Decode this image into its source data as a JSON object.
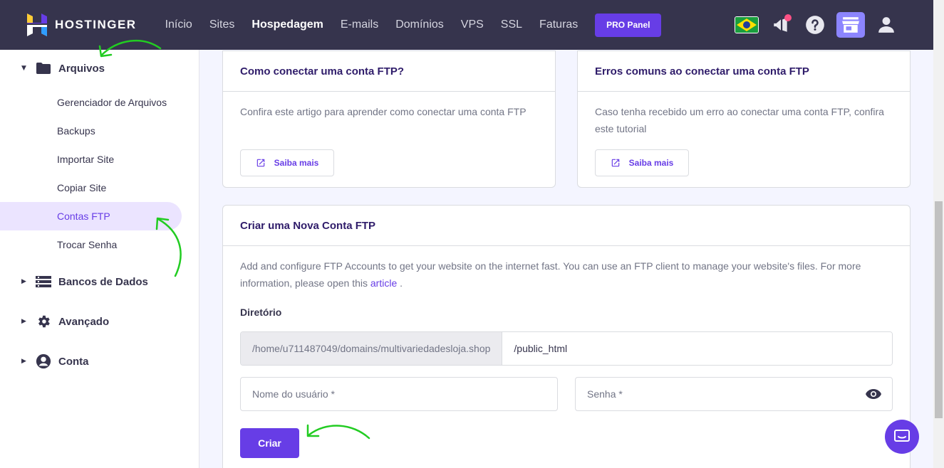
{
  "brand": {
    "name": "HOSTINGER"
  },
  "nav": {
    "items": [
      {
        "label": "Início"
      },
      {
        "label": "Sites"
      },
      {
        "label": "Hospedagem",
        "active": true
      },
      {
        "label": "E-mails"
      },
      {
        "label": "Domínios"
      },
      {
        "label": "VPS"
      },
      {
        "label": "SSL"
      },
      {
        "label": "Faturas"
      }
    ],
    "pro_panel": "PRO Panel"
  },
  "top_icons": [
    "brazil-flag-icon",
    "megaphone-icon",
    "help-icon",
    "store-icon",
    "user-icon"
  ],
  "sidebar": {
    "arquivos": "Arquivos",
    "subitems": [
      {
        "label": "Gerenciador de Arquivos"
      },
      {
        "label": "Backups"
      },
      {
        "label": "Importar Site"
      },
      {
        "label": "Copiar Site"
      },
      {
        "label": "Contas FTP",
        "active": true
      },
      {
        "label": "Trocar Senha"
      }
    ],
    "bancos": "Bancos de Dados",
    "avancado": "Avançado",
    "conta": "Conta"
  },
  "card1": {
    "title": "Como conectar uma conta FTP?",
    "text": "Confira este artigo para aprender como conectar uma conta FTP",
    "button": "Saiba mais"
  },
  "card2": {
    "title": "Erros comuns ao conectar uma conta FTP",
    "text": "Caso tenha recebido um erro ao conectar uma conta FTP, confira este tutorial",
    "button": "Saiba mais"
  },
  "create": {
    "title": "Criar uma Nova Conta FTP",
    "description": "Add and configure FTP Accounts to get your website on the internet fast. You can use an FTP client to manage your website's files. For more information, please open this",
    "link": "article",
    "after_link": " .",
    "dir_label": "Diretório",
    "dir_prefix": "/home/u711487049/domains/multivariedadesloja.shop",
    "dir_value": "/public_html",
    "username_placeholder": "Nome do usuário *",
    "password_placeholder": "Senha *",
    "submit": "Criar"
  },
  "colors": {
    "topbar": "#36344d",
    "accent": "#673de6",
    "active_bg": "#ebe4ff",
    "annotation_arrow": "#22cc22"
  }
}
